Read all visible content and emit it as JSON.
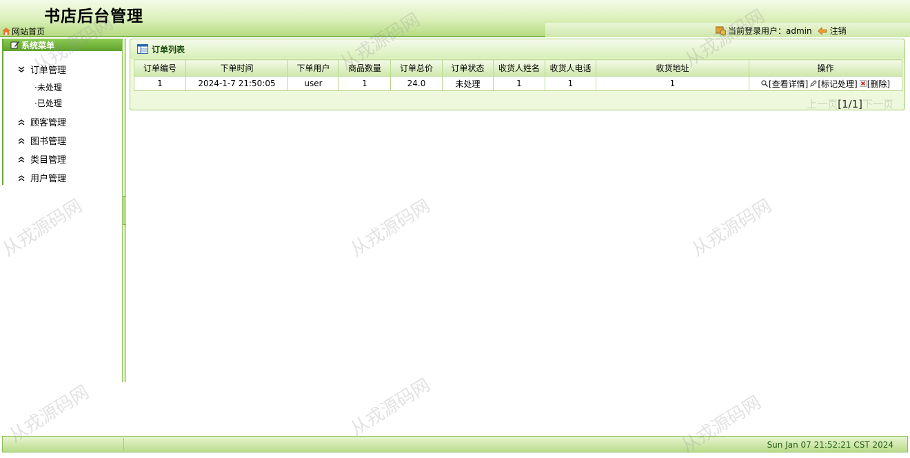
{
  "header": {
    "title": "书店后台管理",
    "home_label": "网站首页",
    "login_prefix": "当前登录用户：",
    "username": "admin",
    "logout_label": "注销"
  },
  "sidebar": {
    "title": "系统菜单",
    "groups": [
      {
        "label": "订单管理",
        "expanded": true,
        "items": [
          "·未处理",
          "·已处理"
        ]
      },
      {
        "label": "顾客管理",
        "expanded": false
      },
      {
        "label": "图书管理",
        "expanded": false
      },
      {
        "label": "类目管理",
        "expanded": false
      },
      {
        "label": "用户管理",
        "expanded": false
      }
    ]
  },
  "panel": {
    "title": "订单列表",
    "columns": [
      "订单编号",
      "下单时间",
      "下单用户",
      "商品数量",
      "订单总价",
      "订单状态",
      "收货人姓名",
      "收货人电话",
      "收货地址",
      "操作"
    ],
    "rows": [
      {
        "cells": [
          "1",
          "2024-1-7 21:50:05",
          "user",
          "1",
          "24.0",
          "未处理",
          "1",
          "1",
          "1"
        ],
        "ops": {
          "view": "[查看详情]",
          "mark": "[标记处理]",
          "delete": "[删除]"
        }
      }
    ],
    "pager": {
      "prev": "上一页",
      "current": "[1/1]",
      "next": "下一页"
    }
  },
  "footer": {
    "clock": "Sun Jan 07 21:52:21 CST 2024"
  },
  "watermark": "从戎源码网",
  "colors": {
    "accent": "#6aa839",
    "header_light": "#f4fbe8",
    "header_dark": "#b7dc84"
  }
}
